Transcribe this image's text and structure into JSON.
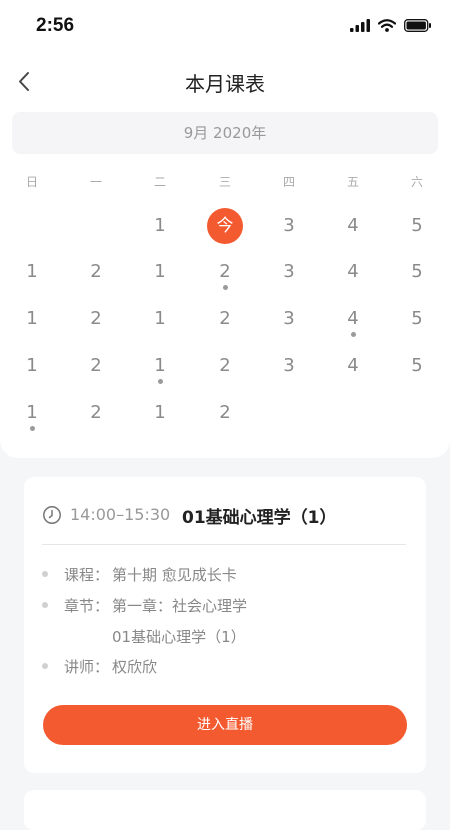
{
  "status_bar": {
    "time": "2:56"
  },
  "header": {
    "title": "本月课表"
  },
  "calendar": {
    "month_label": "9月 2020年",
    "weekdays": [
      "日",
      "一",
      "二",
      "三",
      "四",
      "五",
      "六"
    ],
    "rows": [
      [
        "",
        "",
        "1",
        "今",
        "3",
        "4",
        "5"
      ],
      [
        "1",
        "2",
        "1",
        "2",
        "3",
        "4",
        "5"
      ],
      [
        "1",
        "2",
        "1",
        "2",
        "3",
        "4",
        "5"
      ],
      [
        "1",
        "2",
        "1",
        "2",
        "3",
        "4",
        "5"
      ],
      [
        "1",
        "2",
        "1",
        "2",
        "",
        "",
        ""
      ]
    ],
    "today": [
      0,
      3
    ],
    "marked_days": [
      [
        1,
        3
      ],
      [
        2,
        5
      ],
      [
        3,
        2
      ],
      [
        4,
        0
      ]
    ]
  },
  "course_card": {
    "time_range": "14:00–15:30",
    "title": "01基础心理学（1）",
    "course_label": "课程：",
    "course_value": "第十期 愈见成长卡",
    "chapter_label": "章节：",
    "chapter_value": "第一章：社会心理学",
    "chapter_value_line2": "01基础心理学（1）",
    "teacher_label": "讲师：",
    "teacher_value": "权欣欣",
    "enter_button_label": "进入直播"
  },
  "colors": {
    "accent": "#f45a2f",
    "dot": "#9a9a9a"
  },
  "icons": {
    "back": "chevron-left-icon",
    "clock": "clock-icon",
    "signal": "cellular-signal-icon",
    "wifi": "wifi-icon",
    "battery": "battery-icon"
  }
}
